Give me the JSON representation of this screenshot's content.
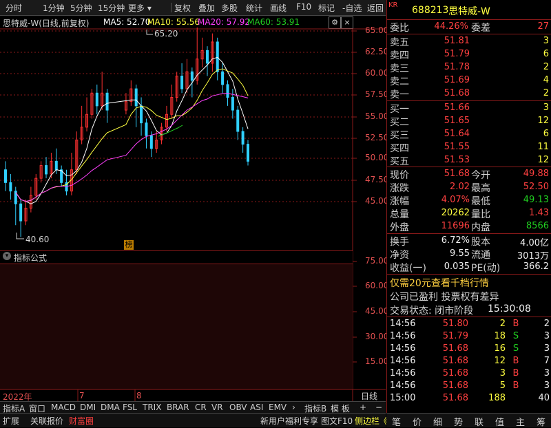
{
  "toolbar": {
    "items": [
      "分时",
      "1分钟",
      "5分钟",
      "15分钟",
      "更多",
      "复权",
      "叠加",
      "多股",
      "统计",
      "画线",
      "F10",
      "标记",
      "-自选",
      "返回"
    ]
  },
  "info": {
    "name_label": "思特威-W(日线,前复权)",
    "ma5": "MA5: 52.70",
    "ma10": "MA10: 55.56",
    "ma20": "MA20: 57.92",
    "ma60": "MA60: 53.91",
    "colors": {
      "ma5": "#ffffff",
      "ma10": "#ffff40",
      "ma20": "#ff40ff",
      "ma60": "#20d020"
    }
  },
  "chart_data": {
    "type": "candlestick",
    "y_axis_ticks": [
      "65.00",
      "62.50",
      "60.00",
      "57.50",
      "55.00",
      "52.50",
      "50.00",
      "47.50",
      "45.00"
    ],
    "ylim": [
      40.0,
      66.0
    ],
    "high_label": "65.20",
    "low_label": "40.60",
    "x_labels": [
      "2022年",
      "7",
      "8"
    ],
    "marker": "榜",
    "indicator_ticks": [
      "75.00",
      "60.00",
      "45.00",
      "30.00",
      "15.00"
    ]
  },
  "indicator": {
    "title": "指标公式"
  },
  "bottom_tabs": {
    "items": [
      "指标A",
      "窗口",
      "MACD",
      "DMI",
      "DMA",
      "FSL",
      "TRIX",
      "BRAR",
      "CR",
      "VR",
      "OBV",
      "ASI",
      "EMV"
    ],
    "extra": [
      "指标B",
      "模 板",
      "+",
      "−"
    ],
    "timeframe": "日线"
  },
  "status": {
    "items": [
      "扩展",
      "关联报价",
      "财富圈"
    ],
    "right": [
      "新用户福利专享",
      "图文F10",
      "侧边栏《"
    ]
  },
  "quote": {
    "tag": "KR",
    "code": "688213",
    "name": "思特威-W",
    "weibi_label": "委比",
    "weibi": "44.26%",
    "weicha_label": "委差",
    "weicha": "27",
    "sells": [
      {
        "label": "卖五",
        "price": "51.81",
        "vol": "3"
      },
      {
        "label": "卖四",
        "price": "51.79",
        "vol": "6"
      },
      {
        "label": "卖三",
        "price": "51.78",
        "vol": "2"
      },
      {
        "label": "卖二",
        "price": "51.69",
        "vol": "4"
      },
      {
        "label": "卖一",
        "price": "51.68",
        "vol": "2"
      }
    ],
    "buys": [
      {
        "label": "买一",
        "price": "51.66",
        "vol": "3"
      },
      {
        "label": "买二",
        "price": "51.65",
        "vol": "12"
      },
      {
        "label": "买三",
        "price": "51.64",
        "vol": "6"
      },
      {
        "label": "买四",
        "price": "51.55",
        "vol": "11"
      },
      {
        "label": "买五",
        "price": "51.53",
        "vol": "12"
      }
    ],
    "stats": [
      {
        "l1": "现价",
        "v1": "51.68",
        "c1": "red",
        "l2": "今开",
        "v2": "49.88",
        "c2": "red"
      },
      {
        "l1": "涨跌",
        "v1": "2.02",
        "c1": "red",
        "l2": "最高",
        "v2": "52.50",
        "c2": "red"
      },
      {
        "l1": "涨幅",
        "v1": "4.07%",
        "c1": "red",
        "l2": "最低",
        "v2": "49.13",
        "c2": "green"
      },
      {
        "l1": "总量",
        "v1": "20262",
        "c1": "yellow",
        "l2": "量比",
        "v2": "1.43",
        "c2": "red"
      },
      {
        "l1": "外盘",
        "v1": "11696",
        "c1": "red",
        "l2": "内盘",
        "v2": "8566",
        "c2": "green"
      }
    ],
    "stats2": [
      {
        "l1": "换手",
        "v1": "6.72%",
        "l2": "股本",
        "v2": "4.00亿"
      },
      {
        "l1": "净资",
        "v1": "9.55",
        "l2": "流通",
        "v2": "3013万"
      },
      {
        "l1": "收益(一)",
        "v1": "0.035",
        "l2": "PE(动)",
        "v2": "366.2"
      }
    ],
    "promo": "仅需20元查看千档行情",
    "notice": "公司已盈利 投票权有差异",
    "trade_status_label": "交易状态: 闭市阶段",
    "trade_status_time": "15:30:08",
    "ticks": [
      {
        "time": "14:56",
        "price": "51.80",
        "vol": "2",
        "side": "B",
        "n": "2"
      },
      {
        "time": "14:56",
        "price": "51.79",
        "vol": "18",
        "side": "S",
        "n": "3"
      },
      {
        "time": "14:56",
        "price": "51.68",
        "vol": "16",
        "side": "S",
        "n": "3"
      },
      {
        "time": "14:56",
        "price": "51.68",
        "vol": "12",
        "side": "B",
        "n": "7"
      },
      {
        "time": "14:56",
        "price": "51.68",
        "vol": "3",
        "side": "B",
        "n": "3"
      },
      {
        "time": "14:56",
        "price": "51.68",
        "vol": "5",
        "side": "B",
        "n": "3"
      },
      {
        "time": "15:00",
        "price": "51.68",
        "vol": "188",
        "side": "",
        "n": "40"
      }
    ],
    "bottom_nav": [
      "笔",
      "价",
      "细",
      "势",
      "联",
      "值",
      "主",
      "筹"
    ]
  }
}
